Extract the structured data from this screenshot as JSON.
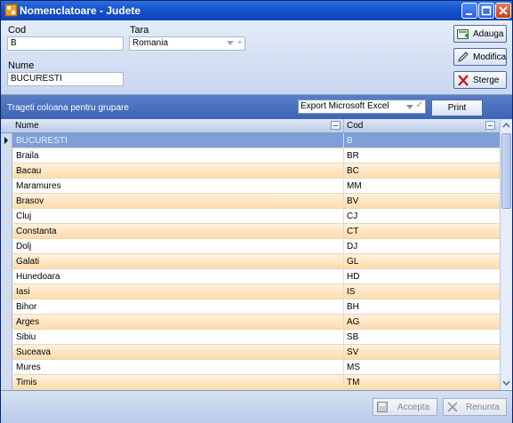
{
  "window": {
    "title": "Nomenclatoare - Judete"
  },
  "form": {
    "cod_label": "Cod",
    "cod_value": "B",
    "tara_label": "Tara",
    "tara_value": "Romania",
    "nume_label": "Nume",
    "nume_value": "BUCURESTI"
  },
  "actions": {
    "add": "Adauga",
    "edit": "Modifica",
    "delete": "Sterge"
  },
  "groupbar": {
    "text": "Trageti coloana pentru grupare",
    "export_value": "Export Microsoft Excel",
    "print": "Print"
  },
  "grid": {
    "columns": [
      "Nume",
      "Cod"
    ],
    "rows": [
      {
        "nume": "BUCURESTI",
        "cod": "B"
      },
      {
        "nume": "Braila",
        "cod": "BR"
      },
      {
        "nume": "Bacau",
        "cod": "BC"
      },
      {
        "nume": "Maramures",
        "cod": "MM"
      },
      {
        "nume": "Brasov",
        "cod": "BV"
      },
      {
        "nume": "Cluj",
        "cod": "CJ"
      },
      {
        "nume": "Constanta",
        "cod": "CT"
      },
      {
        "nume": "Dolj",
        "cod": "DJ"
      },
      {
        "nume": "Galati",
        "cod": "GL"
      },
      {
        "nume": "Hunedoara",
        "cod": "HD"
      },
      {
        "nume": "Iasi",
        "cod": "IS"
      },
      {
        "nume": "Bihor",
        "cod": "BH"
      },
      {
        "nume": "Arges",
        "cod": "AG"
      },
      {
        "nume": "Sibiu",
        "cod": "SB"
      },
      {
        "nume": "Suceava",
        "cod": "SV"
      },
      {
        "nume": "Mures",
        "cod": "MS"
      },
      {
        "nume": "Timis",
        "cod": "TM"
      }
    ]
  },
  "footer": {
    "accept": "Accepta",
    "cancel": "Renunta"
  }
}
